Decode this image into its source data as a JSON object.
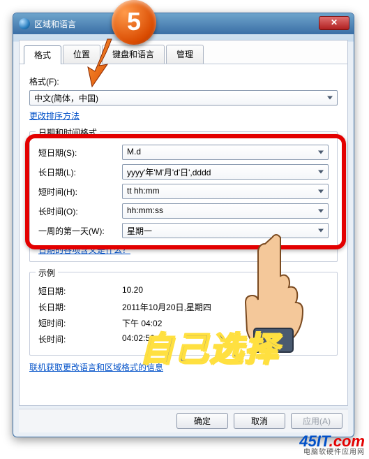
{
  "window": {
    "title": "区域和语言"
  },
  "tabs": {
    "format": "格式",
    "location": "位置",
    "keyboard": "键盘和语言",
    "admin": "管理"
  },
  "format_section": {
    "label": "格式(F):",
    "value": "中文(简体，中国)",
    "sort_link": "更改排序方法"
  },
  "datetime_group": {
    "title": "日期和时间格式",
    "rows": {
      "short_date": {
        "label": "短日期(S):",
        "value": "M.d"
      },
      "long_date": {
        "label": "长日期(L):",
        "value": "yyyy'年'M'月'd'日',dddd"
      },
      "short_time": {
        "label": "短时间(H):",
        "value": "tt hh:mm"
      },
      "long_time": {
        "label": "长时间(O):",
        "value": "hh:mm:ss"
      },
      "first_day": {
        "label": "一周的第一天(W):",
        "value": "星期一"
      }
    },
    "meaning_link": "日期的各项含义是什么？"
  },
  "examples": {
    "title": "示例",
    "rows": {
      "short_date": {
        "label": "短日期:",
        "value": "10.20"
      },
      "long_date": {
        "label": "长日期:",
        "value": "2011年10月20日,星期四"
      },
      "short_time": {
        "label": "短时间:",
        "value": "下午 04:02"
      },
      "long_time": {
        "label": "长时间:",
        "value": "04:02:56"
      }
    }
  },
  "online_link": "联机获取更改语言和区域格式的信息",
  "buttons": {
    "ok": "确定",
    "cancel": "取消",
    "apply": "应用(A)"
  },
  "annotations": {
    "step_number": "5",
    "overlay_text": "自己选择",
    "watermark_brand": "45IT",
    "watermark_suffix": ".com",
    "watermark_sub": "电脑软硬件应用网"
  }
}
